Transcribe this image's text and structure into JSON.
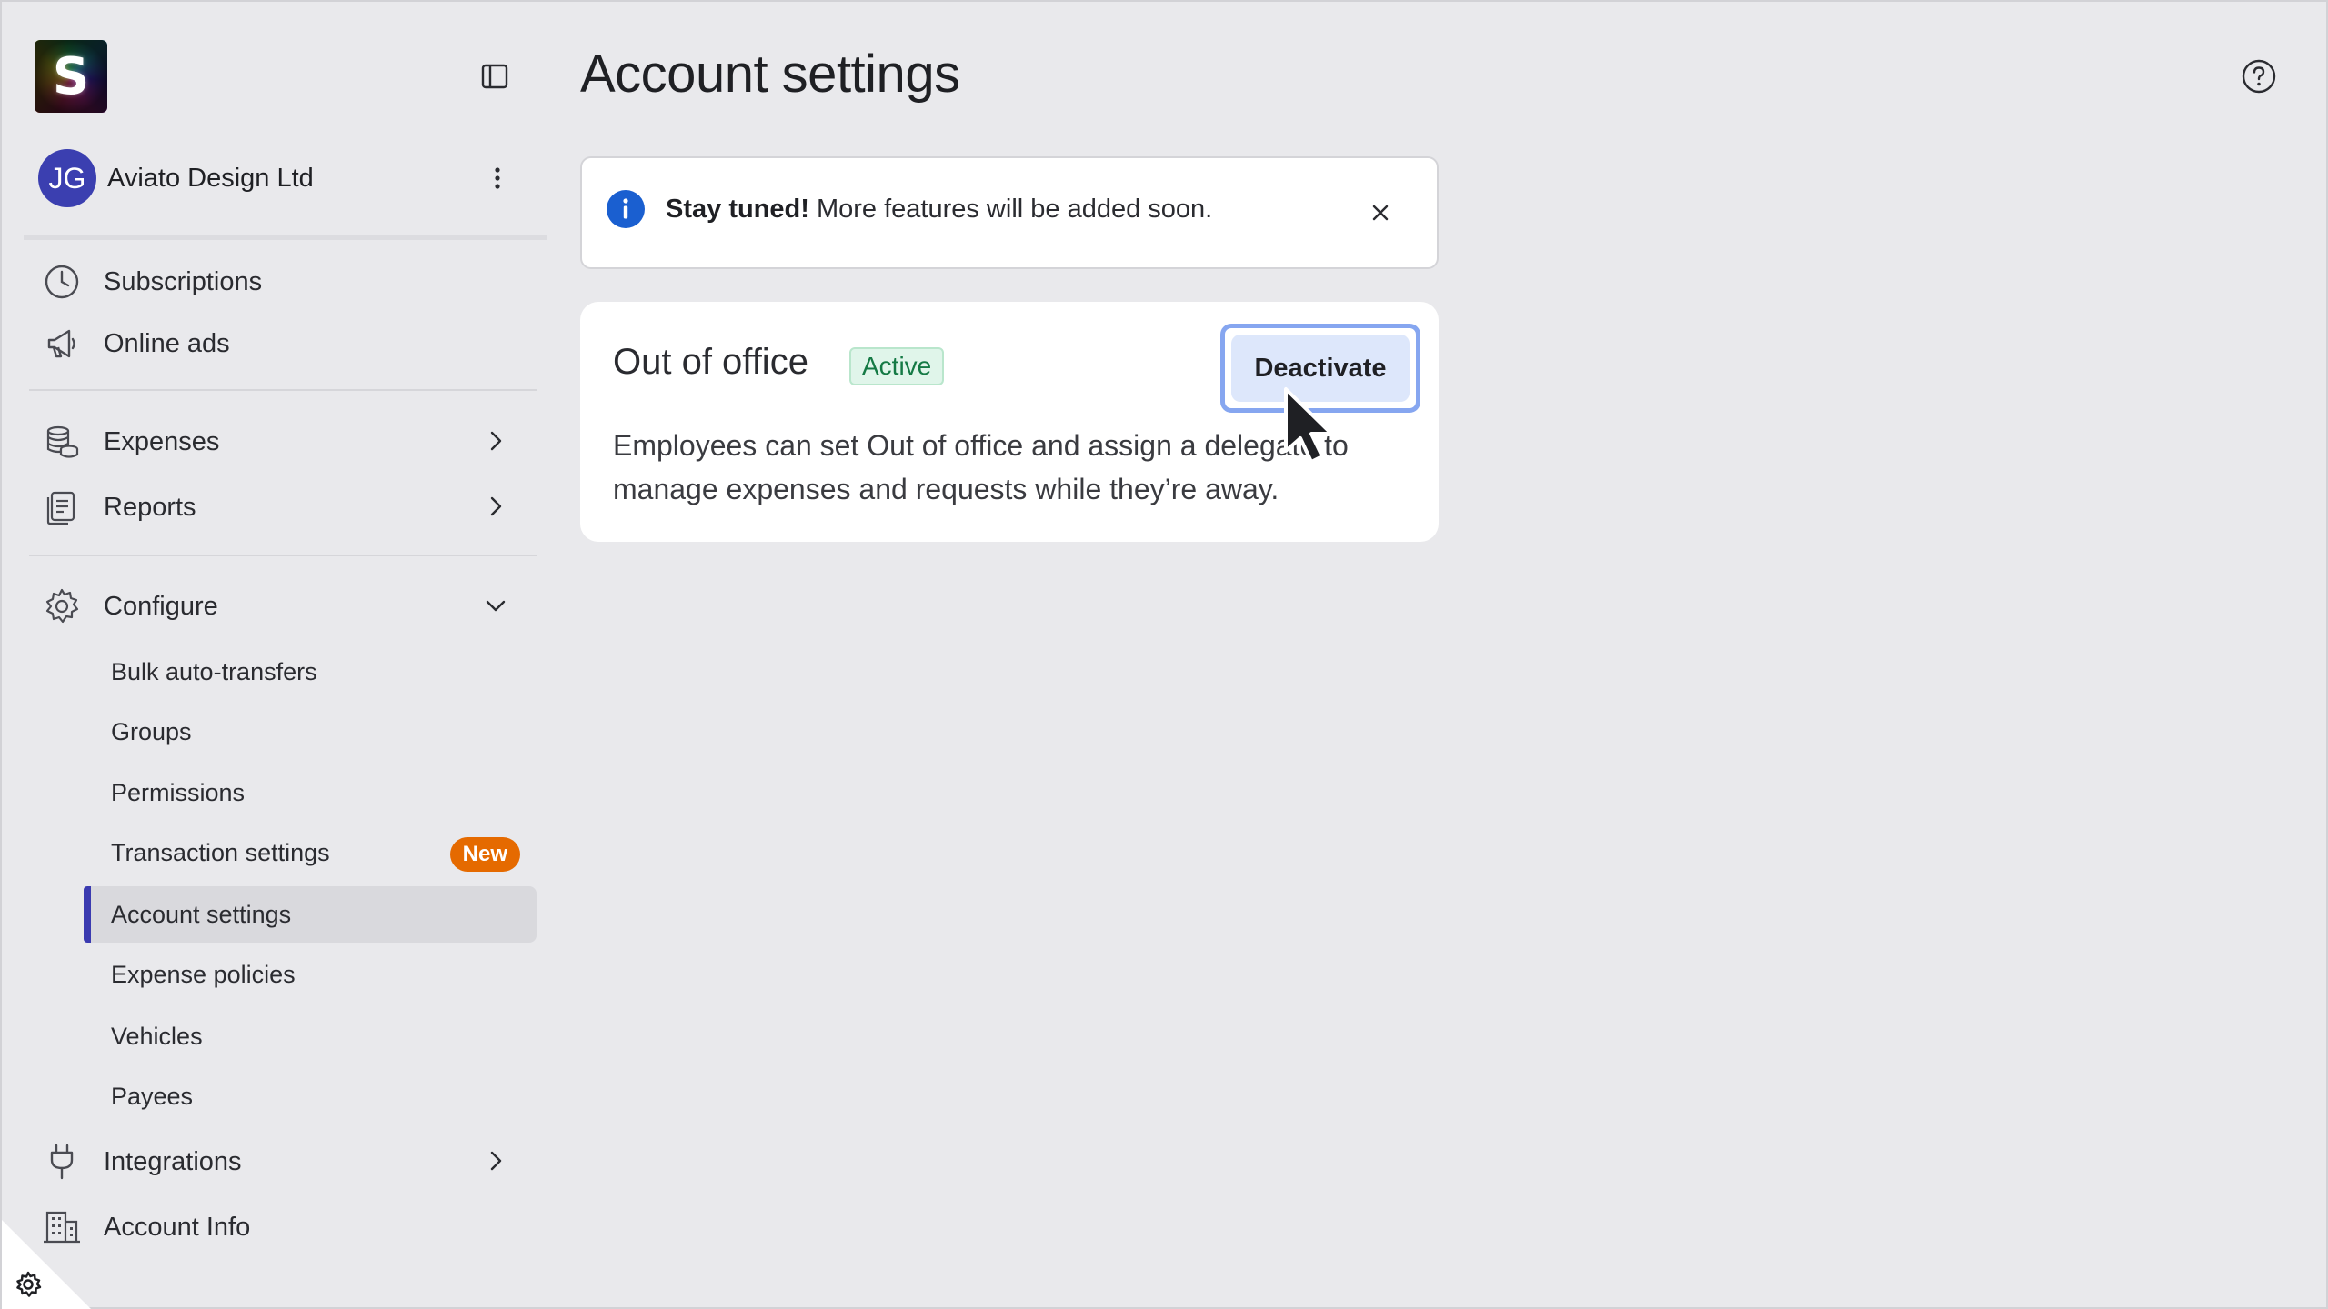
{
  "app": {
    "logo_letter": "S"
  },
  "org": {
    "initials": "JG",
    "name": "Aviato Design Ltd"
  },
  "sidebar": {
    "items": [
      {
        "label": "Subscriptions",
        "icon": "clock-icon"
      },
      {
        "label": "Online ads",
        "icon": "megaphone-icon"
      },
      {
        "label": "Expenses",
        "icon": "coins-icon"
      },
      {
        "label": "Reports",
        "icon": "reports-icon"
      },
      {
        "label": "Configure",
        "icon": "gear-icon"
      },
      {
        "label": "Integrations",
        "icon": "plug-icon"
      },
      {
        "label": "Account Info",
        "icon": "building-icon"
      }
    ],
    "configure_children": [
      {
        "label": "Bulk auto-transfers"
      },
      {
        "label": "Groups"
      },
      {
        "label": "Permissions"
      },
      {
        "label": "Transaction settings",
        "badge": "New"
      },
      {
        "label": "Account settings",
        "active": true
      },
      {
        "label": "Expense policies"
      },
      {
        "label": "Vehicles"
      },
      {
        "label": "Payees"
      }
    ]
  },
  "main": {
    "title": "Account settings",
    "banner": {
      "bold": "Stay tuned!",
      "text": " More features will be added soon."
    },
    "card": {
      "title": "Out of office",
      "status": "Active",
      "button": "Deactivate",
      "description": "Employees can set Out of office and assign a delegate to manage expenses and requests while they’re away."
    }
  },
  "colors": {
    "accent": "#3a3ab0",
    "badge_new": "#e56a00",
    "status_active_text": "#157a45",
    "status_active_bg": "#e0f5ea",
    "info_blue": "#1a5fd0",
    "button_bg": "#dde7fb"
  }
}
